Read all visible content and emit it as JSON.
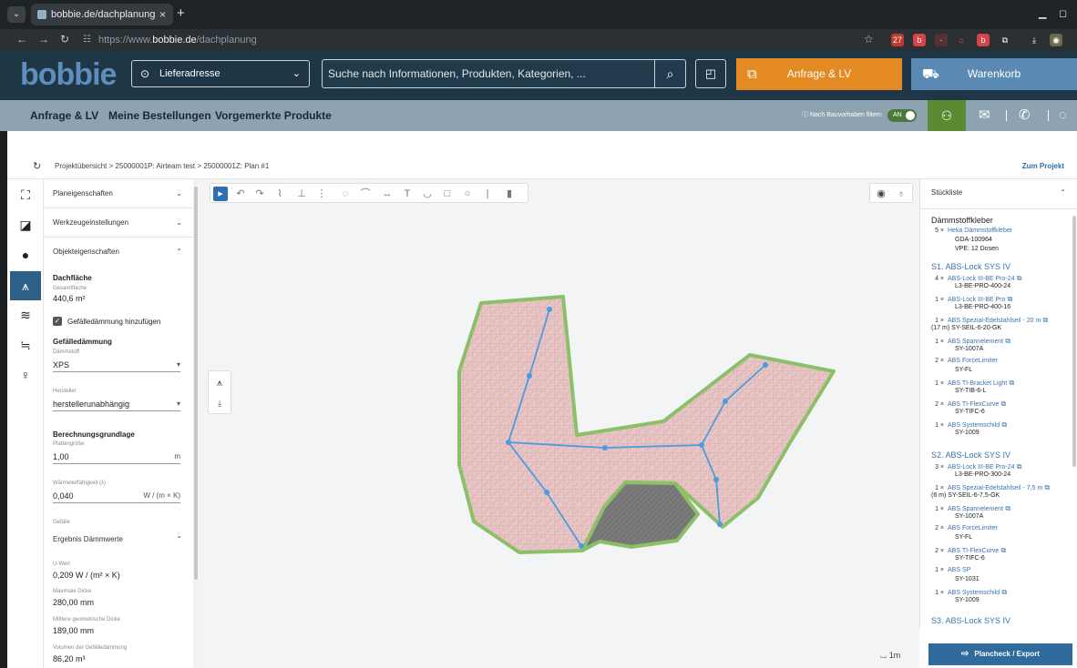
{
  "browser": {
    "tab_title": "bobbie.de/dachplanung",
    "url_prefix": "https://www.",
    "url_host": "bobbie.de",
    "url_path": "/dachplanung",
    "ext_badge": "27"
  },
  "header": {
    "logo": "bobbie",
    "address_label": "Lieferadresse",
    "search_placeholder": "Suche nach Informationen, Produkten, Kategorien, ...",
    "anfrage_label": "Anfrage & LV",
    "cart_label": "Warenkorb"
  },
  "subnav": {
    "items": [
      "Anfrage & LV",
      "Meine Bestellungen",
      "Vorgemerkte Produkte"
    ],
    "filter_label": "Nach Bauvorhaben filtern",
    "toggle_label": "AN"
  },
  "breadcrumb": {
    "items": [
      "Projektübersicht",
      "25000001P: Airteam test",
      "25000001Z: Plan #1"
    ],
    "separator": ">",
    "to_project": "Zum Projekt"
  },
  "props": {
    "sections": {
      "plane": "Planeigenschaften",
      "tools": "Werkzeugeinstellungen",
      "object": "Objekteigenschaften",
      "results": "Ergebnis Dämmwerte"
    },
    "dachflaeche": "Dachfläche",
    "gesamtflaeche_label": "Gesamtfläche",
    "gesamtflaeche_value": "440,6 m²",
    "checkbox_label": "Gefälledämmung hinzufügen",
    "gefaelle_head": "Gefälledämmung",
    "daemmstoff_label": "Dämmstoff",
    "daemmstoff_value": "XPS",
    "hersteller_label": "Hersteller",
    "hersteller_value": "herstellerunabhängig",
    "berechnung_head": "Berechnungsgrundlage",
    "platten_label": "Plattengröße",
    "platten_value": "1,00",
    "platten_unit": "m",
    "waerme_label": "Wärmeleitfähigkeit (λ)",
    "waerme_value": "0,040",
    "waerme_unit": "W / (m × K)",
    "gefaelle_label": "Gefälle",
    "uwert_label": "U-Wert",
    "uwert_value": "0,209 W / (m² × K)",
    "maxdicke_label": "Maximale Dicke",
    "maxdicke_value": "280,00 mm",
    "mittdicke_label": "Mittlere geometrische Dicke",
    "mittdicke_value": "189,00 mm",
    "volumen_label": "Volumen der Gefälledämmung",
    "volumen_value": "86,20 m³"
  },
  "canvas": {
    "scale_label": "1m"
  },
  "stueckliste": {
    "title": "Stückliste",
    "group0": "Dämmstoffkleber",
    "g0_rows": [
      {
        "q": "5 ×",
        "name": "Heka Dämmstoffkleber",
        "sub": [
          "GDA-100964",
          "VPE: 12 Dosen"
        ]
      }
    ],
    "group1": "S1. ABS-Lock SYS IV",
    "g1_rows": [
      {
        "q": "4 ×",
        "name": "ABS-Lock III-BE Pro-24",
        "sub": [
          "L3-BE-PRO-400-24"
        ]
      },
      {
        "q": "1 ×",
        "name": "ABS-Lock III-BE Pro",
        "sub": [
          "L3-BE-PRO-400-16"
        ]
      },
      {
        "q": "1 ×",
        "name": "ABS Spezial-Edelstahlseil - 20 m",
        "sub": [
          "(17 m) SY-SEIL-6-20-GK"
        ]
      },
      {
        "q": "1 ×",
        "name": "ABS Spannelement",
        "sub": [
          "SY-1007A"
        ]
      },
      {
        "q": "2 ×",
        "name": "ABS ForceLimiter",
        "sub": [
          "SY-FL"
        ]
      },
      {
        "q": "1 ×",
        "name": "ABS TI-Bracket Light",
        "sub": [
          "SY-TIB-6-L"
        ]
      },
      {
        "q": "2 ×",
        "name": "ABS TI-FlexCurve",
        "sub": [
          "SY-TIFC-6"
        ]
      },
      {
        "q": "1 ×",
        "name": "ABS Systemschild",
        "sub": [
          "SY-1009"
        ]
      }
    ],
    "group2": "S2. ABS-Lock SYS IV",
    "g2_rows": [
      {
        "q": "3 ×",
        "name": "ABS-Lock III-BE Pro-24",
        "sub": [
          "L3-BE-PRO-300-24"
        ]
      },
      {
        "q": "1 ×",
        "name": "ABS Spezial-Edelstahlseil - 7,5 m",
        "sub": [
          "(6 m) SY-SEIL-6-7,5-GK"
        ]
      },
      {
        "q": "1 ×",
        "name": "ABS Spannelement",
        "sub": [
          "SY-1007A"
        ]
      },
      {
        "q": "2 ×",
        "name": "ABS ForceLimiter",
        "sub": [
          "SY-FL"
        ]
      },
      {
        "q": "2 ×",
        "name": "ABS TI-FlexCurve",
        "sub": [
          "SY-TIFC-6"
        ]
      },
      {
        "q": "1 ×",
        "name": "ABS SP",
        "sub": [
          "SY-1031"
        ]
      },
      {
        "q": "1 ×",
        "name": "ABS Systemschild",
        "sub": [
          "SY-1009"
        ]
      }
    ],
    "group3": "S3. ABS-Lock SYS IV",
    "export_label": "Plancheck / Export"
  },
  "colors": {
    "header_bg": "#1e3646",
    "logo": "#5d8ebc",
    "anfrage": "#e38a22",
    "cart": "#5a8ab4",
    "subnav": "#8da3b2",
    "user": "#5a8a32",
    "roof_fill": "#e9c4c4",
    "roof_edge": "#8cc068",
    "anchor_line": "#4a9bdf"
  }
}
